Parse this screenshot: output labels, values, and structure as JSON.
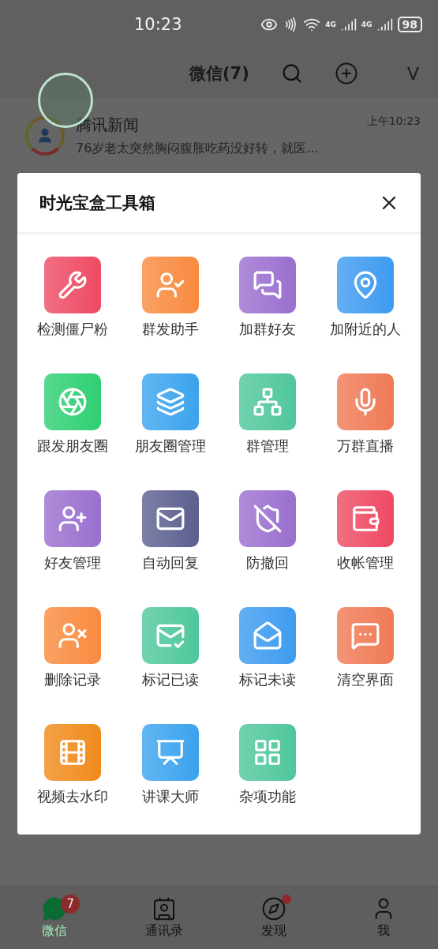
{
  "status_bar": {
    "time": "10:23",
    "battery": "98",
    "signal_labels": [
      "4G",
      "4G"
    ]
  },
  "header": {
    "title": "微信(7)",
    "extra": "V"
  },
  "chat": {
    "name": "腾讯新闻",
    "time": "上午10:23",
    "preview": "76岁老太突然胸闷腹胀吃药没好转，就医..."
  },
  "dialog": {
    "title": "时光宝盒工具箱",
    "tools": [
      {
        "label": "检测僵尸粉",
        "color": "#ee4a63"
      },
      {
        "label": "群发助手",
        "color": "#f98a3f"
      },
      {
        "label": "加群好友",
        "color": "#9a6fcf"
      },
      {
        "label": "加附近的人",
        "color": "#3d9bf0"
      },
      {
        "label": "跟发朋友圈",
        "color": "#2ecf73"
      },
      {
        "label": "朋友圈管理",
        "color": "#3aa3ee"
      },
      {
        "label": "群管理",
        "color": "#4fc79b"
      },
      {
        "label": "万群直播",
        "color": "#f07a55"
      },
      {
        "label": "好友管理",
        "color": "#9a6fcf"
      },
      {
        "label": "自动回复",
        "color": "#5c5f8f"
      },
      {
        "label": "防撤回",
        "color": "#9a6fcf"
      },
      {
        "label": "收帐管理",
        "color": "#ee4a63"
      },
      {
        "label": "删除记录",
        "color": "#f98a3f"
      },
      {
        "label": "标记已读",
        "color": "#4fc79b"
      },
      {
        "label": "标记未读",
        "color": "#3d9bf0"
      },
      {
        "label": "清空界面",
        "color": "#f07a55"
      },
      {
        "label": "视频去水印",
        "color": "#f08a1a"
      },
      {
        "label": "讲课大师",
        "color": "#3aa3ee"
      },
      {
        "label": "杂项功能",
        "color": "#4fc79b"
      }
    ]
  },
  "tabs": [
    {
      "label": "微信",
      "selected": true,
      "badge": "7",
      "dot": false
    },
    {
      "label": "通讯录",
      "selected": false,
      "dot": false
    },
    {
      "label": "发现",
      "selected": false,
      "dot": true
    },
    {
      "label": "我",
      "selected": false,
      "dot": false
    }
  ]
}
